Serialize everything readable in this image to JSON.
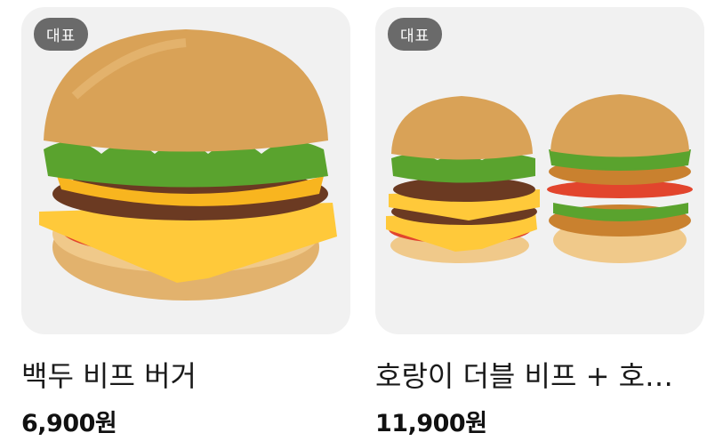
{
  "products": [
    {
      "badge": "대표",
      "name": "백두 비프 버거",
      "price": "6,900원",
      "image_icon": "burger-image"
    },
    {
      "badge": "대표",
      "name": "호랑이 더블 비프 + 호…",
      "price": "11,900원",
      "image_icon": "double-burger-image"
    }
  ],
  "colors": {
    "bun": "#d9a257",
    "lettuce": "#5aa32e",
    "cheese": "#ffc93a",
    "patty": "#6b3a22",
    "tomato": "#e2452d",
    "bg": "#f1f1f1"
  }
}
